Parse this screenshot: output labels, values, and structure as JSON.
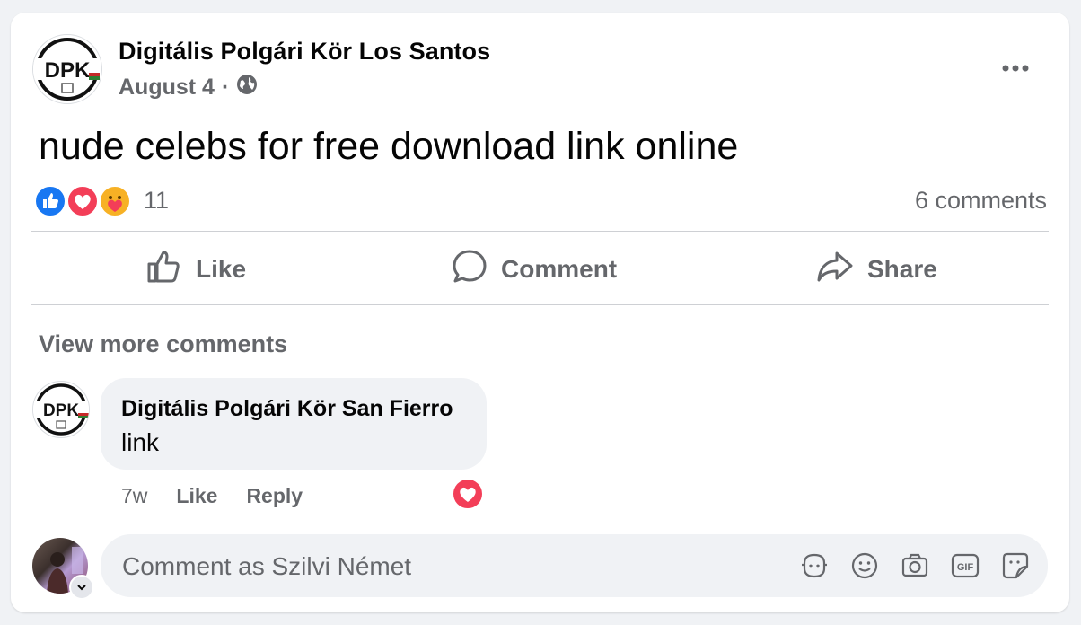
{
  "post": {
    "page_name": "Digitális Polgári Kör Los Santos",
    "date": "August 4",
    "separator": "·",
    "text": "nude celebs for free download link online",
    "avatar_initials": "DPK",
    "reaction_count": "11",
    "comments_count": "6 comments",
    "reactions": [
      "like-icon",
      "love-icon",
      "care-icon"
    ]
  },
  "actions": {
    "like": "Like",
    "comment": "Comment",
    "share": "Share"
  },
  "comments_section": {
    "view_more": "View more comments",
    "items": [
      {
        "author": "Digitális Polgári Kör San Fierro",
        "avatar_initials": "DPK",
        "text": "link",
        "time": "7w",
        "like": "Like",
        "reply": "Reply",
        "reaction": "love-icon"
      }
    ]
  },
  "composer": {
    "placeholder": "Comment as Szilvi Német",
    "tools": [
      "avatar-sticker-icon",
      "emoji-icon",
      "camera-icon",
      "gif-icon",
      "sticker-icon"
    ]
  },
  "colors": {
    "like_blue": "#1877f2",
    "love_red": "#f33e58",
    "secondary_text": "#65676b",
    "bubble_bg": "#f0f2f5"
  }
}
